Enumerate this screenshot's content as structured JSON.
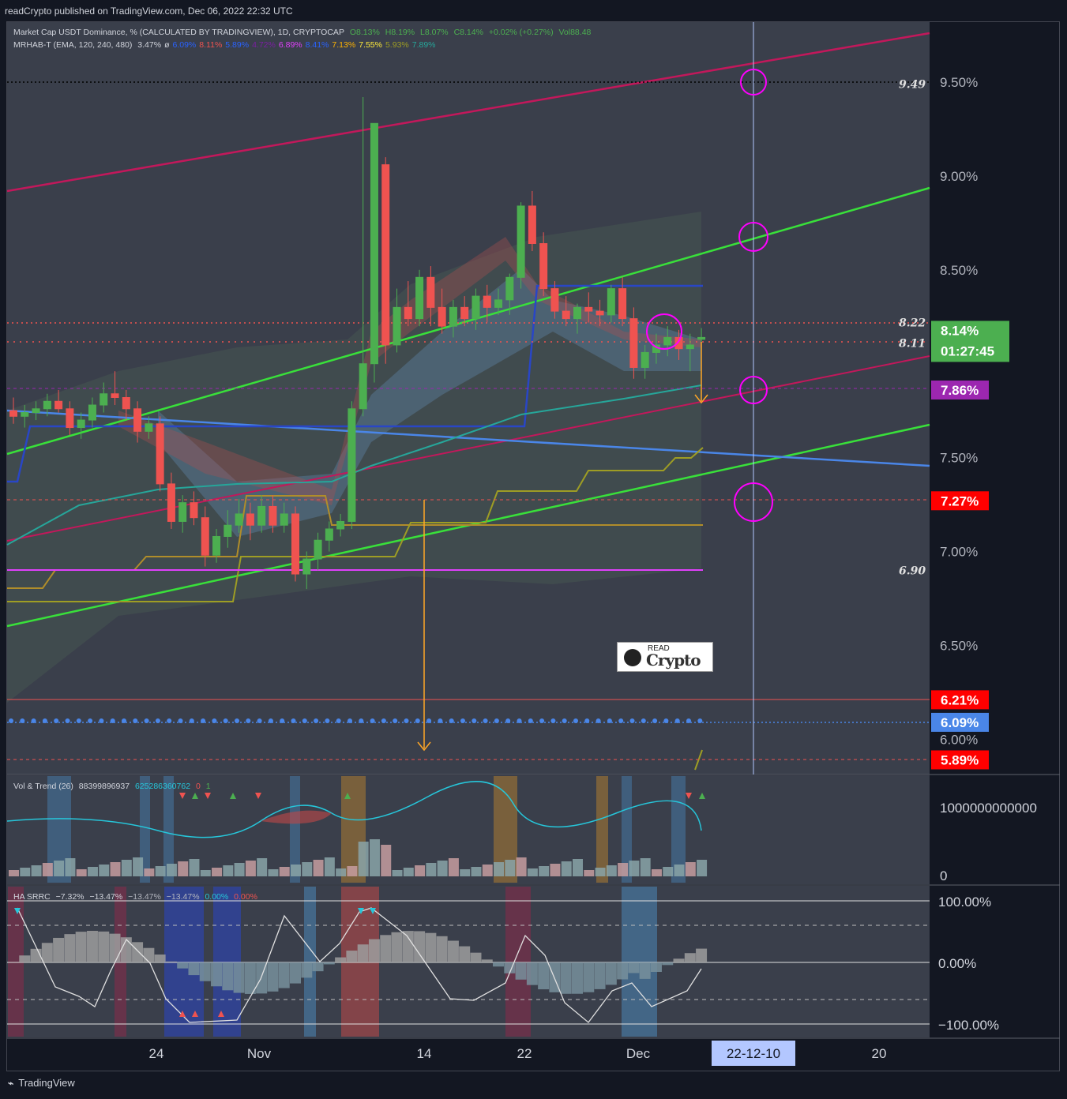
{
  "header": {
    "published_text": "readCrypto published on TradingView.com, Dec 06, 2022 22:32 UTC"
  },
  "legend_main": {
    "symbol": "Market Cap USDT Dominance, % (CALCULATED BY TRADINGVIEW), 1D, CRYPTOCAP",
    "open": "O8.13%",
    "high": "H8.19%",
    "low": "L8.07%",
    "close": "C8.14%",
    "change": "+0.02% (+0.27%)",
    "vol": "Vol88.48"
  },
  "legend_mrhab": {
    "name": "MRHAB-T (EMA, 120, 240, 480)",
    "vals": [
      "3.47%",
      "ø",
      "6.09%",
      "8.11%",
      "5.89%",
      "4.72%",
      "6.89%",
      "8.41%",
      "7.13%",
      "7.55%",
      "5.93%",
      "7.89%"
    ],
    "colors": [
      "#d1d4dc",
      "#d1d4dc",
      "#2962ff",
      "#ef5350",
      "#2962ff",
      "#7b1fa2",
      "#e040fb",
      "#2962ff",
      "#ffb300",
      "#ffeb3b",
      "#9e9d24",
      "#26a69a"
    ]
  },
  "legend_vol": {
    "name": "Vol & Trend (26)",
    "v1": "88399896937",
    "v2": "625286360762",
    "v3": "0",
    "v4": "1"
  },
  "legend_srrc": {
    "name": "HA SRRC",
    "v1": "−7.32%",
    "v2": "−13.47%",
    "v3": "−13.47%",
    "v4": "−13.47%",
    "v5": "0.00%",
    "v6": "0.00%"
  },
  "price_axis": {
    "ticks": [
      "9.50%",
      "9.00%",
      "8.50%",
      "7.50%",
      "7.00%",
      "6.50%",
      "6.00%"
    ],
    "tick_values": [
      9.5,
      9.0,
      8.5,
      7.5,
      7.0,
      6.5,
      6.0
    ]
  },
  "price_labels": [
    {
      "text": "8.14%",
      "sub": "01:27:45",
      "value": 8.14,
      "bg": "#4caf50"
    },
    {
      "text": "7.86%",
      "value": 7.86,
      "bg": "#9c27b0"
    },
    {
      "text": "7.27%",
      "value": 7.27,
      "bg": "#ff0000"
    },
    {
      "text": "6.21%",
      "value": 6.21,
      "bg": "#ff0000"
    },
    {
      "text": "6.09%",
      "value": 6.09,
      "bg": "#4a86e8"
    },
    {
      "text": "5.89%",
      "value": 5.89,
      "bg": "#ff0000"
    }
  ],
  "level_labels": [
    {
      "text": "9.49",
      "value": 9.49
    },
    {
      "text": "8.22",
      "value": 8.22
    },
    {
      "text": "8.11",
      "value": 8.11
    },
    {
      "text": "6.90",
      "value": 6.9
    }
  ],
  "vol_axis": {
    "top": "1000000000000",
    "bottom": "0"
  },
  "srrc_axis": {
    "ticks": [
      "100.00%",
      "0.00%",
      "−100.00%"
    ]
  },
  "time_axis": {
    "labels": [
      "24",
      "Nov",
      "14",
      "22",
      "Dec",
      "20"
    ],
    "cursor_label": "22-12-10"
  },
  "watermark": {
    "line1": "READ",
    "line2": "Crypto"
  },
  "footer": {
    "brand": "TradingView"
  },
  "chart_data": {
    "type": "candlestick",
    "title": "Market Cap USDT Dominance, % (CALCULATED BY TRADINGVIEW), 1D, CRYPTOCAP",
    "x_labels": [
      "24",
      "Nov",
      "14",
      "22",
      "Dec",
      "20"
    ],
    "ylim": [
      5.85,
      9.85
    ],
    "candles": [
      [
        7.75,
        7.82,
        7.68,
        7.72
      ],
      [
        7.72,
        7.78,
        7.66,
        7.74
      ],
      [
        7.74,
        7.8,
        7.7,
        7.76
      ],
      [
        7.76,
        7.84,
        7.72,
        7.8
      ],
      [
        7.8,
        7.86,
        7.74,
        7.76
      ],
      [
        7.76,
        7.8,
        7.62,
        7.66
      ],
      [
        7.66,
        7.74,
        7.6,
        7.7
      ],
      [
        7.7,
        7.82,
        7.66,
        7.78
      ],
      [
        7.78,
        7.9,
        7.74,
        7.84
      ],
      [
        7.84,
        7.96,
        7.78,
        7.82
      ],
      [
        7.82,
        7.86,
        7.7,
        7.76
      ],
      [
        7.76,
        7.8,
        7.58,
        7.64
      ],
      [
        7.64,
        7.72,
        7.6,
        7.68
      ],
      [
        7.68,
        7.72,
        7.32,
        7.36
      ],
      [
        7.36,
        7.42,
        7.12,
        7.16
      ],
      [
        7.16,
        7.3,
        7.1,
        7.26
      ],
      [
        7.26,
        7.32,
        7.14,
        7.18
      ],
      [
        7.18,
        7.24,
        6.92,
        6.98
      ],
      [
        6.98,
        7.12,
        6.94,
        7.08
      ],
      [
        7.08,
        7.22,
        7.02,
        7.14
      ],
      [
        7.14,
        7.28,
        7.1,
        7.2
      ],
      [
        7.2,
        7.26,
        7.06,
        7.14
      ],
      [
        7.14,
        7.3,
        7.1,
        7.24
      ],
      [
        7.24,
        7.3,
        7.1,
        7.14
      ],
      [
        7.14,
        7.26,
        7.1,
        7.2
      ],
      [
        7.2,
        7.24,
        6.84,
        6.88
      ],
      [
        6.88,
        7.0,
        6.8,
        6.96
      ],
      [
        6.96,
        7.1,
        6.9,
        7.06
      ],
      [
        7.06,
        7.16,
        7.0,
        7.12
      ],
      [
        7.12,
        7.2,
        7.08,
        7.16
      ],
      [
        7.16,
        7.8,
        7.12,
        7.76
      ],
      [
        7.76,
        9.42,
        7.72,
        8.0
      ],
      [
        8.0,
        9.06,
        7.9,
        9.28
      ],
      [
        9.06,
        9.1,
        8.0,
        8.1
      ],
      [
        8.1,
        8.4,
        8.06,
        8.3
      ],
      [
        8.3,
        8.44,
        8.2,
        8.24
      ],
      [
        8.24,
        8.5,
        8.2,
        8.46
      ],
      [
        8.46,
        8.52,
        8.2,
        8.3
      ],
      [
        8.3,
        8.4,
        8.16,
        8.2
      ],
      [
        8.2,
        8.34,
        8.14,
        8.3
      ],
      [
        8.3,
        8.36,
        8.2,
        8.24
      ],
      [
        8.24,
        8.4,
        8.18,
        8.36
      ],
      [
        8.36,
        8.42,
        8.22,
        8.3
      ],
      [
        8.3,
        8.4,
        8.26,
        8.34
      ],
      [
        8.34,
        8.48,
        8.26,
        8.46
      ],
      [
        8.46,
        8.86,
        8.4,
        8.84
      ],
      [
        8.84,
        8.92,
        8.6,
        8.64
      ],
      [
        8.64,
        8.7,
        8.36,
        8.4
      ],
      [
        8.4,
        8.44,
        8.24,
        8.28
      ],
      [
        8.28,
        8.36,
        8.2,
        8.24
      ],
      [
        8.24,
        8.32,
        8.16,
        8.3
      ],
      [
        8.3,
        8.38,
        8.22,
        8.28
      ],
      [
        8.28,
        8.34,
        8.2,
        8.26
      ],
      [
        8.26,
        8.42,
        8.22,
        8.4
      ],
      [
        8.4,
        8.46,
        8.2,
        8.24
      ],
      [
        8.24,
        8.3,
        7.92,
        7.98
      ],
      [
        7.98,
        8.1,
        7.92,
        8.06
      ],
      [
        8.06,
        8.16,
        8.0,
        8.1
      ],
      [
        8.1,
        8.2,
        8.04,
        8.14
      ],
      [
        8.14,
        8.18,
        8.02,
        8.08
      ],
      [
        8.08,
        8.16,
        7.96,
        8.1
      ],
      [
        8.13,
        8.19,
        8.07,
        8.14
      ]
    ]
  }
}
